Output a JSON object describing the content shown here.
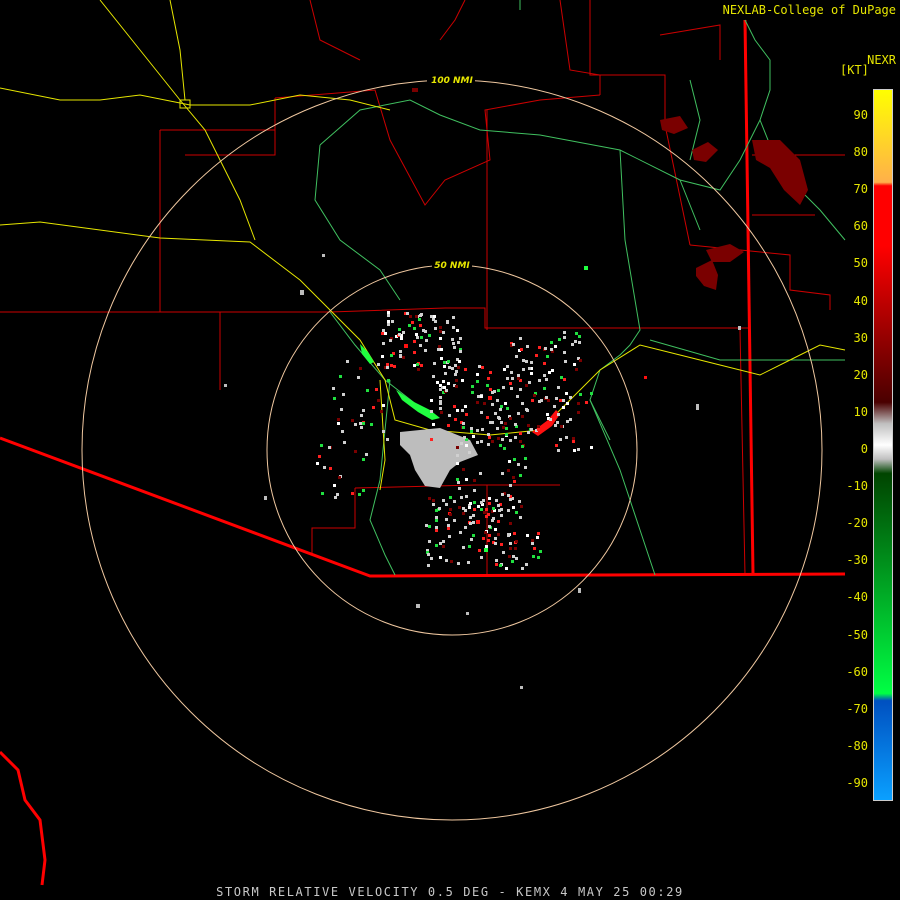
{
  "header": {
    "credit": "NEXLAB-College of DuPage",
    "product": "NEXR",
    "unit": "[KT]"
  },
  "caption": "STORM RELATIVE VELOCITY 0.5 DEG - KEMX 4 MAY 25 00:29",
  "range_rings": [
    {
      "label": "50 NMI",
      "radius_nmi": 50
    },
    {
      "label": "100 NMI",
      "radius_nmi": 100
    }
  ],
  "legend": {
    "ticks": [
      "90",
      "80",
      "70",
      "60",
      "50",
      "40",
      "30",
      "20",
      "10",
      "0",
      "-10",
      "-20",
      "-30",
      "-40",
      "-50",
      "-60",
      "-70",
      "-80",
      "-90"
    ],
    "colors": {
      "top": "#ffff00",
      "orange": "#ffb04a",
      "red": "#ff0000",
      "dark_red": "#4a0000",
      "gray": "#c0c0c0",
      "dark_green": "#004400",
      "green": "#00ff44",
      "blue": "#0050c0",
      "light_blue": "#0aa0ff"
    }
  },
  "colors": {
    "state_lines": "#ff0000",
    "county_lines": "#cc0000",
    "highways": "#e6e600",
    "rivers": "#40c060",
    "rings": "#f0c8a0"
  }
}
